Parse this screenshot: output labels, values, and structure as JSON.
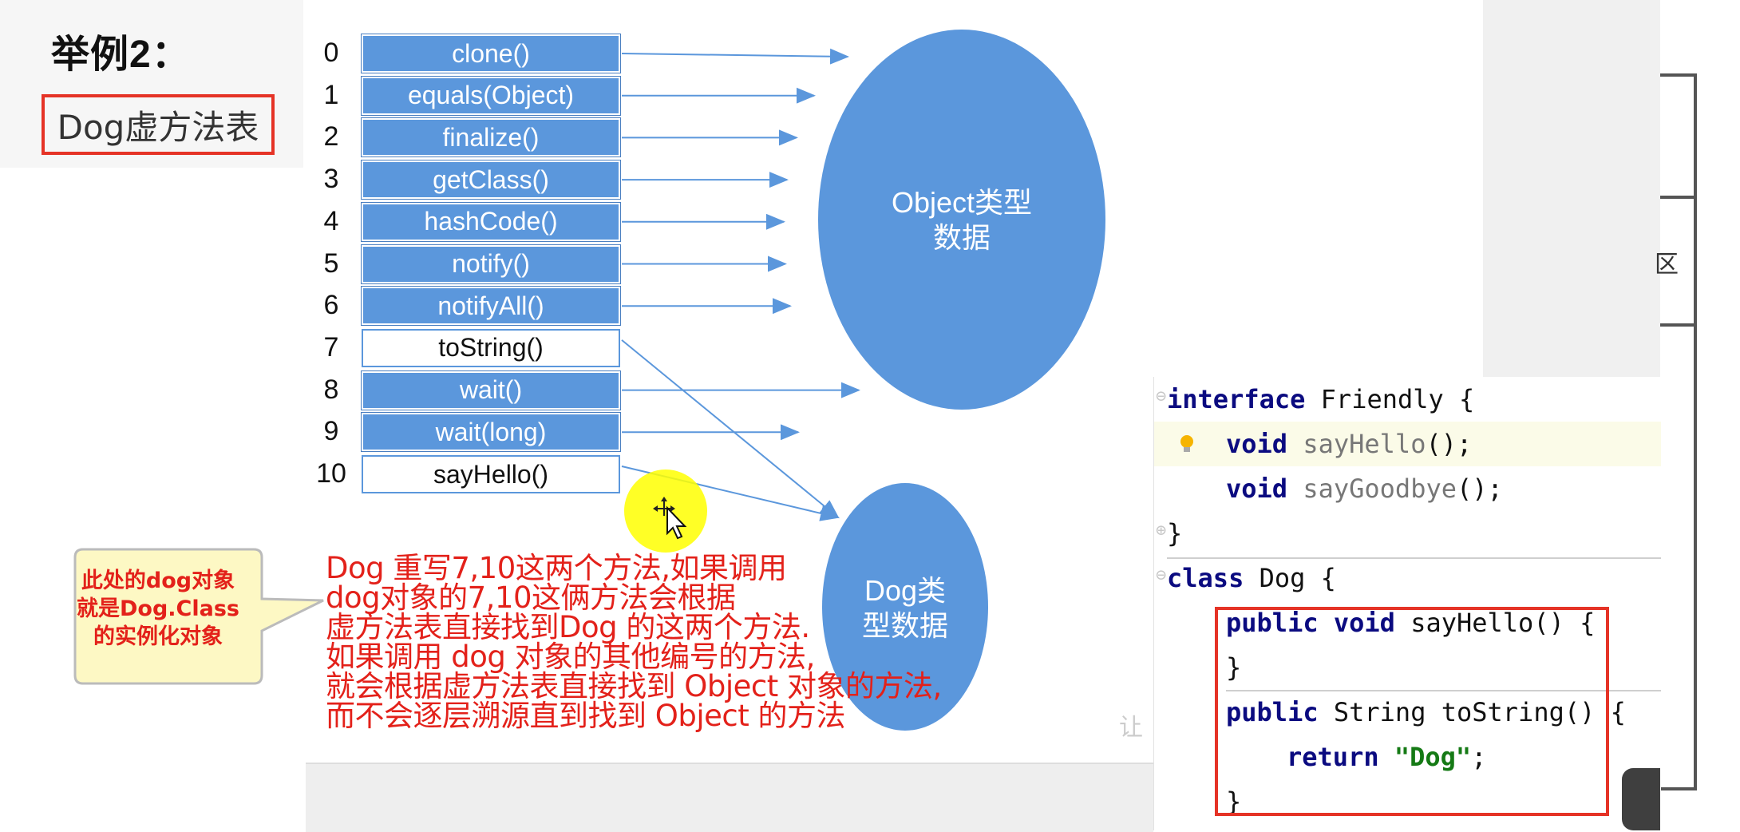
{
  "title": "举例2：",
  "subtitle": "Dog虚方法表",
  "vtable": {
    "rows": [
      {
        "index": "0",
        "method": "clone()",
        "owner": "Object"
      },
      {
        "index": "1",
        "method": "equals(Object)",
        "owner": "Object"
      },
      {
        "index": "2",
        "method": "finalize()",
        "owner": "Object"
      },
      {
        "index": "3",
        "method": "getClass()",
        "owner": "Object"
      },
      {
        "index": "4",
        "method": "hashCode()",
        "owner": "Object"
      },
      {
        "index": "5",
        "method": "notify()",
        "owner": "Object"
      },
      {
        "index": "6",
        "method": "notifyAll()",
        "owner": "Object"
      },
      {
        "index": "7",
        "method": "toString()",
        "owner": "Dog"
      },
      {
        "index": "8",
        "method": "wait()",
        "owner": "Object"
      },
      {
        "index": "9",
        "method": "wait(long)",
        "owner": "Object"
      },
      {
        "index": "10",
        "method": "sayHello()",
        "owner": "Dog"
      }
    ],
    "inherited_color": "#5b97dc",
    "own_color": "#ffffff"
  },
  "object_ellipse": {
    "line1": "Object类型",
    "line2": "数据",
    "color": "#5b97dc"
  },
  "dog_ellipse": {
    "line1": "Dog类",
    "line2": "型数据",
    "color": "#5b97dc"
  },
  "annotation": {
    "lines": [
      "Dog 重写7,10这两个方法,如果调用",
      "dog对象的7,10这俩方法会根据",
      "虚方法表直接找到Dog 的这两个方法.",
      "如果调用 dog 对象的其他编号的方法,",
      "就会根据虚方法表直接找到 Object 对象的方法,",
      "而不会逐层溯源直到找到 Object 的方法"
    ],
    "color": "#e3211a"
  },
  "callout": {
    "lines": [
      "此处的dog对象",
      "就是Dog.Class",
      "的实例化对象"
    ],
    "bg_color": "#fdf8c4",
    "text_color": "#e3211a"
  },
  "code": {
    "line1": {
      "kw": "interface",
      "rest": " Friendly {"
    },
    "line2": {
      "kw": "void",
      "name": "sayHello",
      "tail": "();"
    },
    "line3": {
      "kw": "void",
      "name": "sayGoodbye",
      "tail": "();"
    },
    "line4": "}",
    "line5": {
      "kw": "class",
      "rest": " Dog {"
    },
    "line6": {
      "kw": "public void",
      "rest": " sayHello() {"
    },
    "line7": "}",
    "line8": {
      "kw": "public",
      "rest": " String toString() {"
    },
    "line9": {
      "kw": "return",
      "str": "\"Dog\"",
      "tail": ";"
    },
    "line10": "}"
  },
  "watermark": "让",
  "side_glyph": "区",
  "icons": [
    "lightbulb-icon",
    "move-cursor-icon"
  ]
}
